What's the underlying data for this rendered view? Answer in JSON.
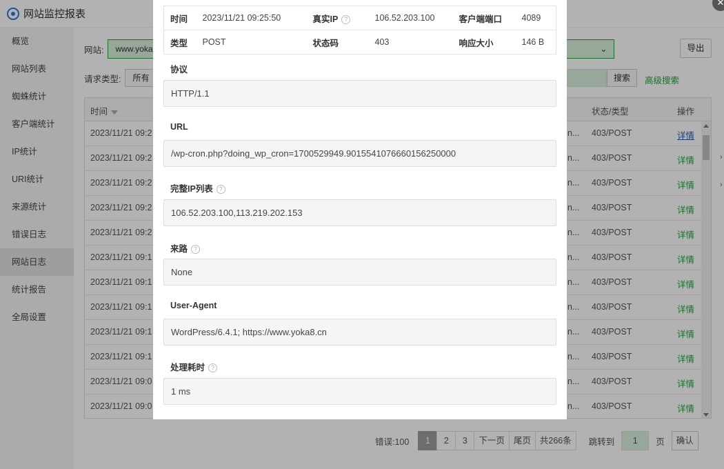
{
  "app": {
    "title": "网站监控报表"
  },
  "sidebar": {
    "items": [
      {
        "label": "概览"
      },
      {
        "label": "网站列表"
      },
      {
        "label": "蜘蛛统计"
      },
      {
        "label": "客户端统计"
      },
      {
        "label": "IP统计"
      },
      {
        "label": "URI统计"
      },
      {
        "label": "来源统计"
      },
      {
        "label": "错误日志"
      },
      {
        "label": "网站日志",
        "active": true
      },
      {
        "label": "统计报告"
      },
      {
        "label": "全局设置"
      }
    ]
  },
  "filters": {
    "site_label": "网站:",
    "site_value": "www.yoka",
    "export_label": "导出",
    "type_label": "请求类型:",
    "type_value": "所有",
    "search_label": "搜索",
    "advanced_search_label": "高级搜索"
  },
  "table": {
    "headers": {
      "time": "时间",
      "status": "状态/类型",
      "op": "操作"
    },
    "rows": [
      {
        "time": "2023/11/21 09:2",
        "ua": "n...",
        "status": "403/POST",
        "op": "详情"
      },
      {
        "time": "2023/11/21 09:2",
        "ua": "n...",
        "status": "403/POST",
        "op": "详情"
      },
      {
        "time": "2023/11/21 09:2",
        "ua": "n...",
        "status": "403/POST",
        "op": "详情"
      },
      {
        "time": "2023/11/21 09:2",
        "ua": "n...",
        "status": "403/POST",
        "op": "详情"
      },
      {
        "time": "2023/11/21 09:2",
        "ua": "n...",
        "status": "403/POST",
        "op": "详情"
      },
      {
        "time": "2023/11/21 09:1",
        "ua": "n...",
        "status": "403/POST",
        "op": "详情"
      },
      {
        "time": "2023/11/21 09:1",
        "ua": "n...",
        "status": "403/POST",
        "op": "详情"
      },
      {
        "time": "2023/11/21 09:1",
        "ua": "n...",
        "status": "403/POST",
        "op": "详情"
      },
      {
        "time": "2023/11/21 09:1",
        "ua": "n...",
        "status": "403/POST",
        "op": "详情"
      },
      {
        "time": "2023/11/21 09:1",
        "ua": "n...",
        "status": "403/POST",
        "op": "详情"
      },
      {
        "time": "2023/11/21 09:0",
        "ua": "n...",
        "status": "403/POST",
        "op": "详情"
      },
      {
        "time": "2023/11/21 09:0",
        "ua": "n...",
        "status": "403/POST",
        "op": "详情"
      }
    ]
  },
  "pager": {
    "errors": "错误:100",
    "pages": [
      "1",
      "2",
      "3"
    ],
    "next": "下一页",
    "last": "尾页",
    "total": "共266条",
    "jump_label": "跳转到",
    "jump_value": "1",
    "page_unit": "页",
    "confirm": "确认"
  },
  "modal": {
    "info": {
      "time_label": "时间",
      "time_value": "2023/11/21 09:25:50",
      "real_ip_label": "真实IP",
      "real_ip_value": "106.52.203.100",
      "client_port_label": "客户端端口",
      "client_port_value": "4089",
      "type_label": "类型",
      "type_value": "POST",
      "status_label": "状态码",
      "status_value": "403",
      "resp_size_label": "响应大小",
      "resp_size_value": "146 B"
    },
    "protocol_label": "协议",
    "protocol_value": "HTTP/1.1",
    "url_label": "URL",
    "url_value": "/wp-cron.php?doing_wp_cron=1700529949.9015541076660156250000",
    "ip_list_label": "完整IP列表",
    "ip_list_value": "106.52.203.100,113.219.202.153",
    "referer_label": "来路",
    "referer_value": "None",
    "ua_label": "User-Agent",
    "ua_value": "WordPress/6.4.1; https://www.yoka8.cn",
    "elapsed_label": "处理耗时",
    "elapsed_value": "1 ms",
    "help_icon": "?"
  },
  "colors": {
    "accent": "#20a53a",
    "link": "#2b5ea8"
  }
}
